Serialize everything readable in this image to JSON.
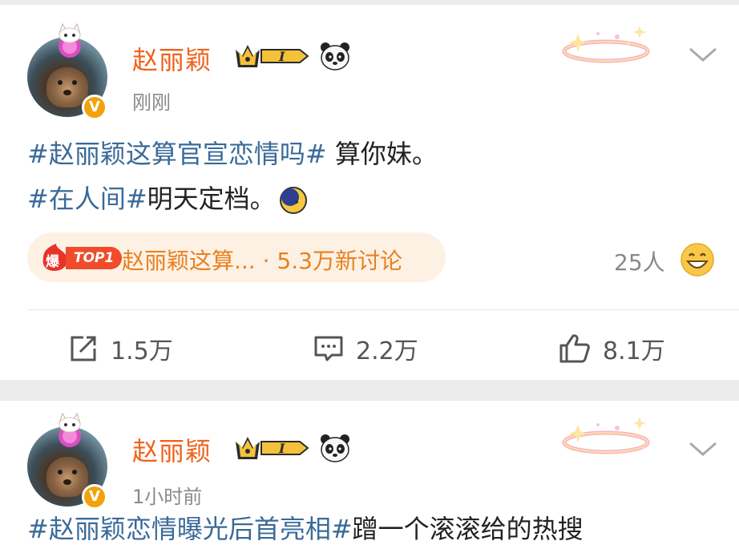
{
  "posts": [
    {
      "username": "赵丽颖",
      "vip_level": "I",
      "timestamp": "刚刚",
      "line1_tag": "#赵丽颖这算官宣恋情吗#",
      "line1_text": " 算你妹。",
      "line2_tag": "#在人间#",
      "line2_text": "明天定档。",
      "hot": {
        "badge": "爆",
        "rank": "TOP1",
        "topic": "赵丽颖这算...",
        "discussions": "· 5.3万新讨论"
      },
      "participants": "25人",
      "actions": {
        "repost": "1.5万",
        "comment": "2.2万",
        "like": "8.1万"
      }
    },
    {
      "username": "赵丽颖",
      "vip_level": "I",
      "timestamp": "1小时前",
      "line1_tag": "#赵丽颖恋情曝光后首亮相#",
      "line1_text": "蹭一个滚滚给的热搜"
    }
  ],
  "icons": {
    "verified": "verified-v-icon",
    "vip": "crown-vip-icon",
    "panda": "panda-icon",
    "more": "chevron-down-icon",
    "repost": "repost-icon",
    "comment": "comment-icon",
    "like": "thumbs-up-icon",
    "smiley": "grinning-face-icon"
  },
  "colors": {
    "username": "#f0621d",
    "hashtag": "#3a6a98",
    "hot_text": "#e8801f",
    "hot_bg": "#fdf1e4",
    "top_badge": "#f04b2b",
    "verified": "#f2a20c"
  }
}
